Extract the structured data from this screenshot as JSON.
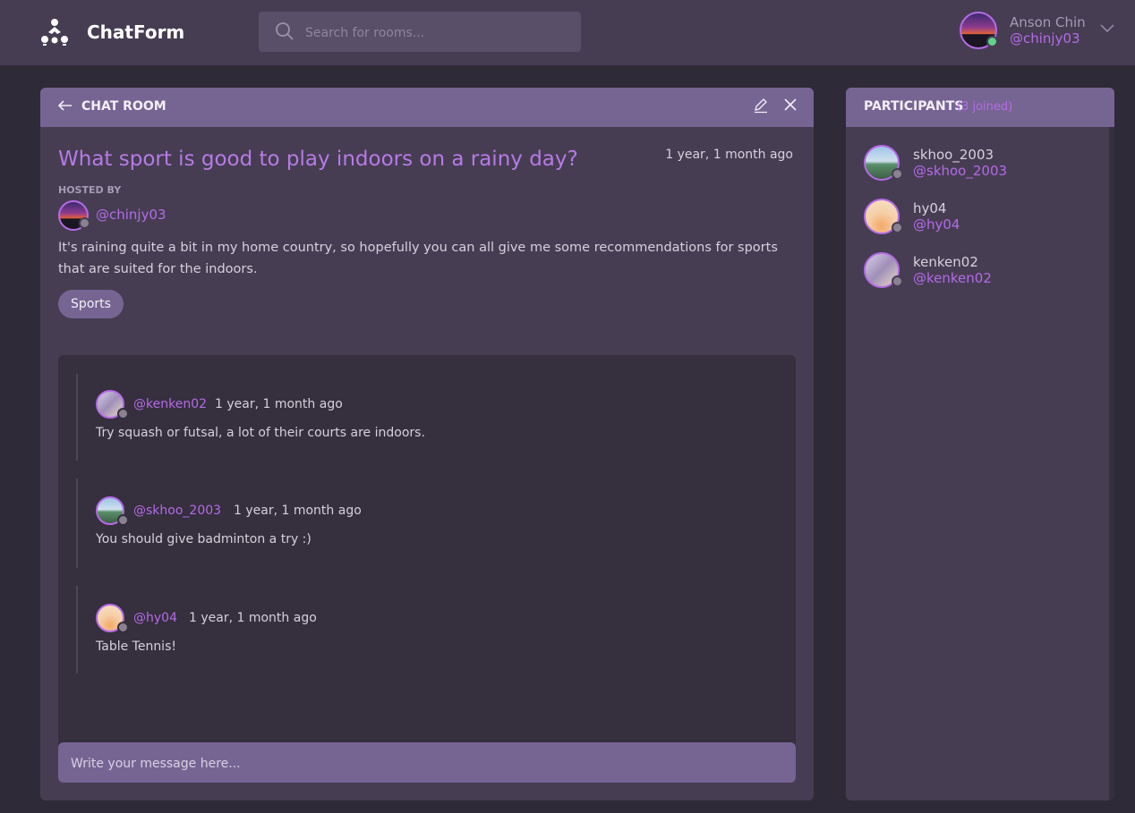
{
  "app": {
    "brand": "ChatForm",
    "logo_icon": "chatform-logo-icon"
  },
  "search": {
    "placeholder": "Search for rooms..."
  },
  "user": {
    "name": "Anson Chin",
    "handle": "@chinjy03",
    "status_color": "#5fd38a"
  },
  "colors": {
    "accent": "#b56be6",
    "header": "#463d53",
    "panel_head": "#766593",
    "background": "#2f2a37"
  },
  "room": {
    "header_label": "CHAT ROOM",
    "topic": "What sport is good to play indoors on a rainy day?",
    "time": "1 year, 1 month ago",
    "hosted_by_label": "HOSTED BY",
    "host_handle": "@chinjy03",
    "description": "It's raining quite a bit in my home country, so hopefully you can all give me some recommendations for sports that are suited for the indoors.",
    "tag": "Sports",
    "messages": [
      {
        "handle": "@kenken02",
        "time": "1 year, 1 month ago",
        "text": "Try squash or futsal, a lot of their courts are indoors."
      },
      {
        "handle": "@skhoo_2003",
        "time": "1 year, 1 month ago",
        "text": "You should give badminton a try :)"
      },
      {
        "handle": "@hy04",
        "time": "1 year, 1 month ago",
        "text": "Table Tennis!"
      }
    ],
    "composer_placeholder": "Write your message here..."
  },
  "participants": {
    "title": "PARTICIPANTS",
    "count": "(3 joined)",
    "list": [
      {
        "name": "skhoo_2003",
        "handle": "@skhoo_2003"
      },
      {
        "name": "hy04",
        "handle": "@hy04"
      },
      {
        "name": "kenken02",
        "handle": "@kenken02"
      }
    ]
  }
}
